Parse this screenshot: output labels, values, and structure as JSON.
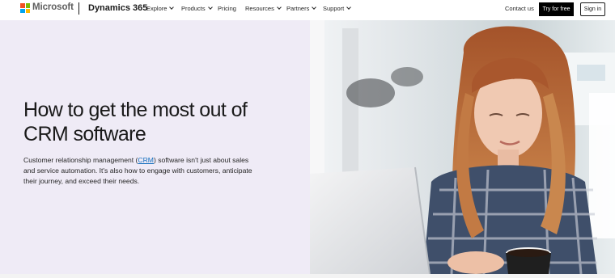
{
  "header": {
    "brand": "Microsoft",
    "product": "Dynamics 365",
    "logo_colors": [
      "#f25022",
      "#7fba00",
      "#00a4ef",
      "#ffb900"
    ],
    "nav": [
      {
        "label": "Explore",
        "has_dropdown": true
      },
      {
        "label": "Products",
        "has_dropdown": true
      },
      {
        "label": "Pricing",
        "has_dropdown": false
      },
      {
        "label": "Resources",
        "has_dropdown": true
      },
      {
        "label": "Partners",
        "has_dropdown": true
      },
      {
        "label": "Support",
        "has_dropdown": true
      }
    ],
    "contact": "Contact us",
    "try_label": "Try for free",
    "signin_label": "Sign in"
  },
  "hero": {
    "title": "How to get the most out of CRM software",
    "desc_before": "Customer relationship management (",
    "desc_link": "CRM",
    "desc_after": ") software isn't just about sales and service automation. It's also how to engage with customers, anticipate their journey, and exceed their needs.",
    "image_icon": "photo-woman-laptop",
    "colors": {
      "hero_bg": "#efebf6",
      "link": "#0f6cbd",
      "button_dark": "#000000"
    }
  }
}
